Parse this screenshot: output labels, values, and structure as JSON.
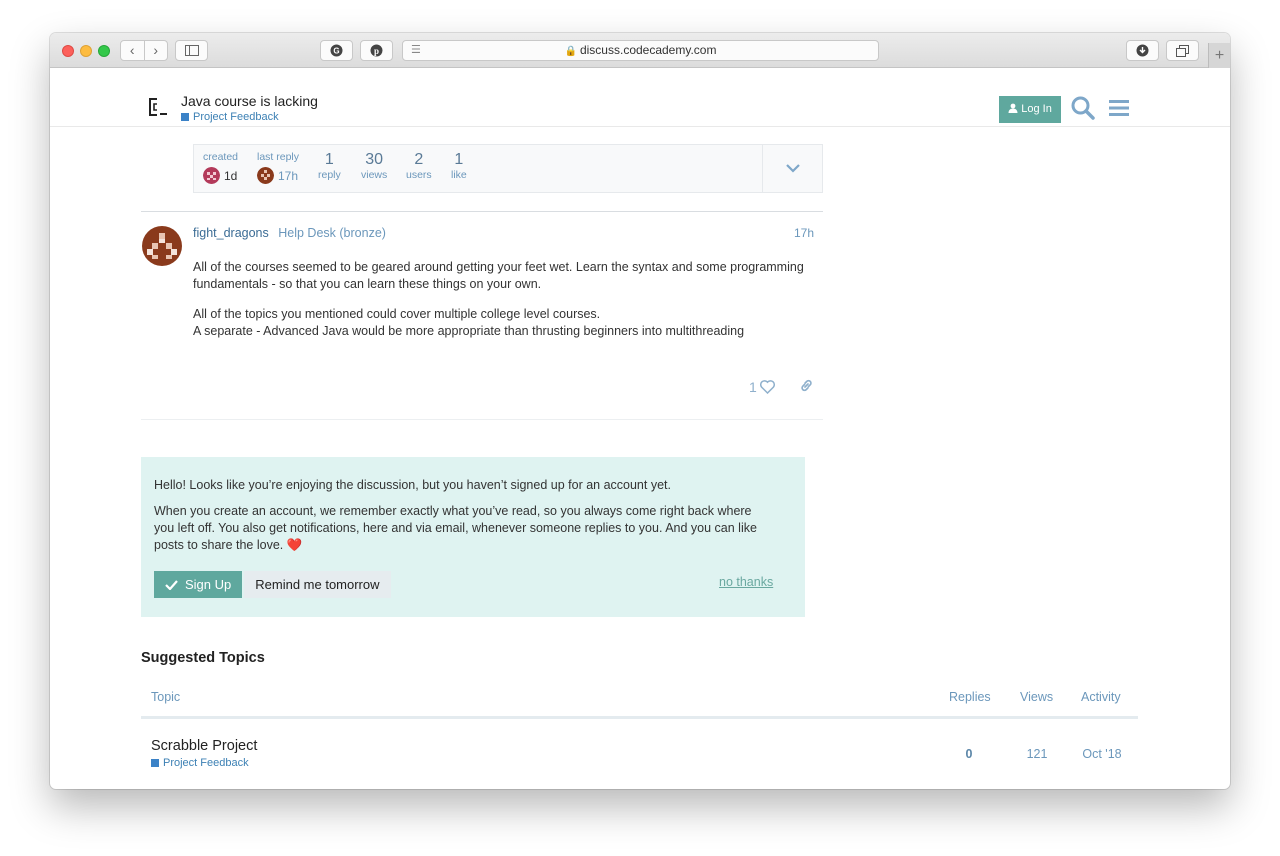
{
  "browser": {
    "url": "discuss.codecademy.com"
  },
  "header": {
    "topic_title": "Java course is lacking",
    "category": "Project Feedback",
    "login_label": "Log In",
    "colors": {
      "accent": "#5fa89e",
      "category": "#3b82c7"
    }
  },
  "topic_map": {
    "created_label": "created",
    "created_ago": "1d",
    "last_reply_label": "last reply",
    "last_reply_ago": "17h",
    "replies_num": "1",
    "replies_label": "reply",
    "views_num": "30",
    "views_label": "views",
    "users_num": "2",
    "users_label": "users",
    "likes_num": "1",
    "likes_label": "like"
  },
  "post": {
    "username": "fight_dragons",
    "user_group": "Help Desk (bronze)",
    "time": "17h",
    "paragraph1": "All of the courses seemed to be geared around getting your feet wet. Learn the syntax and some programming fundamentals - so that you can learn these things on your own.",
    "paragraph2_line1": "All of the topics you mentioned could cover multiple college level courses.",
    "paragraph2_line2": "A separate - Advanced Java would be more appropriate than thrusting beginners into multithreading",
    "like_count": "1"
  },
  "banner": {
    "line1": "Hello! Looks like you’re enjoying the discussion, but you haven’t signed up for an account yet.",
    "line2": "When you create an account, we remember exactly what you’ve read, so you always come right back where you left off. You also get notifications, here and via email, whenever someone replies to you. And you can like posts to share the love.",
    "signup_label": "Sign Up",
    "remind_label": "Remind me tomorrow",
    "no_thanks_label": "no thanks"
  },
  "suggested": {
    "title": "Suggested Topics",
    "columns": {
      "topic": "Topic",
      "replies": "Replies",
      "views": "Views",
      "activity": "Activity"
    },
    "rows": [
      {
        "title": "Scrabble Project",
        "category": "Project Feedback",
        "replies": "0",
        "views": "121",
        "activity": "Oct '18"
      }
    ]
  }
}
